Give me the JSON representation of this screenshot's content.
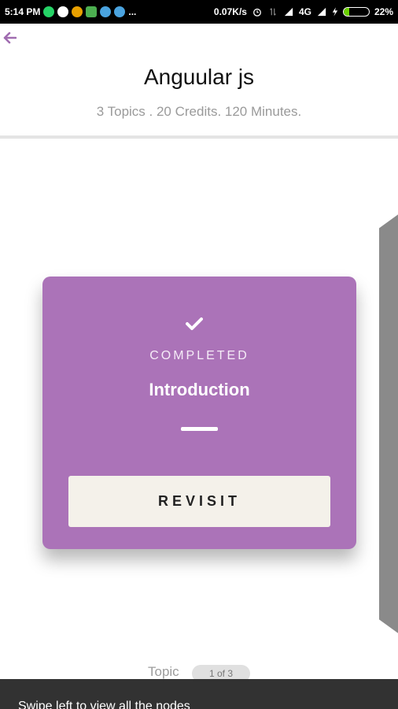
{
  "status_bar": {
    "time": "5:14 PM",
    "more": "...",
    "speed": "0.07K/s",
    "network": "4G",
    "battery": "22%",
    "battery_fraction": 0.22
  },
  "course": {
    "title": "Anguular js",
    "meta": "3 Topics . 20 Credits. 120 Minutes."
  },
  "card": {
    "status": "COMPLETED",
    "title": "Introduction",
    "button_label": "REVISIT",
    "accent": "#ab73b8"
  },
  "pager": {
    "label": "Topic",
    "badge": "1 of 3"
  },
  "snackbar": {
    "message": "Swipe left to view all the nodes"
  }
}
